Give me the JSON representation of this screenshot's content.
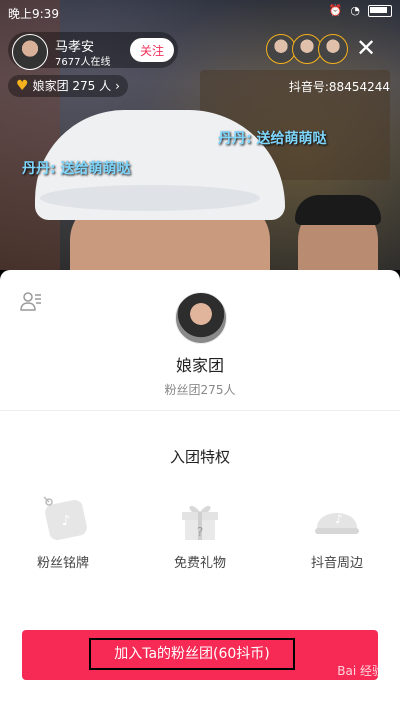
{
  "statusbar": {
    "time": "晚上9:39"
  },
  "host": {
    "name": "马孝安",
    "online": "7677人在线",
    "follow_label": "关注"
  },
  "fan_badge": {
    "label": "娘家团 275 人"
  },
  "close_label": "✕",
  "douyin_id": "抖音号:88454244",
  "gifts": [
    "丹丹: 送给萌萌哒",
    "丹丹: 送给萌萌哒"
  ],
  "sheet": {
    "group_name": "娘家团",
    "group_count": "粉丝团275人",
    "privileges_title": "入团特权",
    "privileges": [
      {
        "label": "粉丝铭牌",
        "icon": "fan-badge-icon"
      },
      {
        "label": "免费礼物",
        "icon": "gift-box-icon"
      },
      {
        "label": "抖音周边",
        "icon": "cap-icon"
      }
    ],
    "join_label": "加入Ta的粉丝团(60抖币)"
  },
  "watermark": "Bai 经验",
  "colors": {
    "accent": "#f72a55",
    "badge": "#f6b21c"
  }
}
